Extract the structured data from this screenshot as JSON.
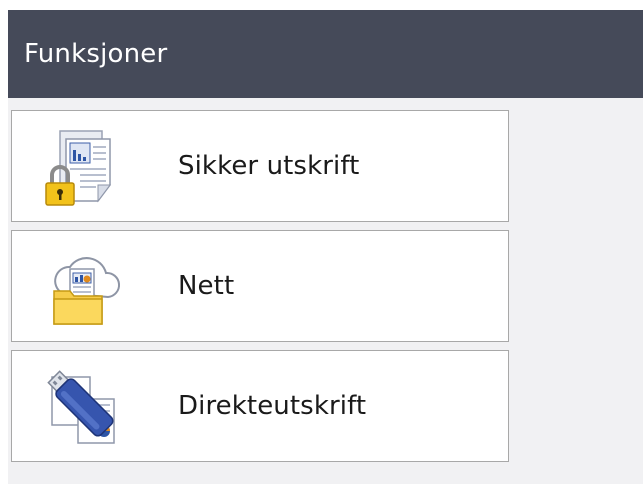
{
  "header": {
    "title": "Funksjoner"
  },
  "menu": {
    "items": [
      {
        "label": "Sikker utskrift",
        "icon": "secure-print-icon"
      },
      {
        "label": "Nett",
        "icon": "web-cloud-folder-icon"
      },
      {
        "label": "Direkteutskrift",
        "icon": "usb-direct-print-icon"
      }
    ]
  },
  "colors": {
    "titlebar_bg": "#454a59",
    "screen_bg": "#f1f1f3",
    "item_bg": "#ffffff",
    "item_border": "#a8a8a8",
    "text": "#1a1a1a"
  }
}
